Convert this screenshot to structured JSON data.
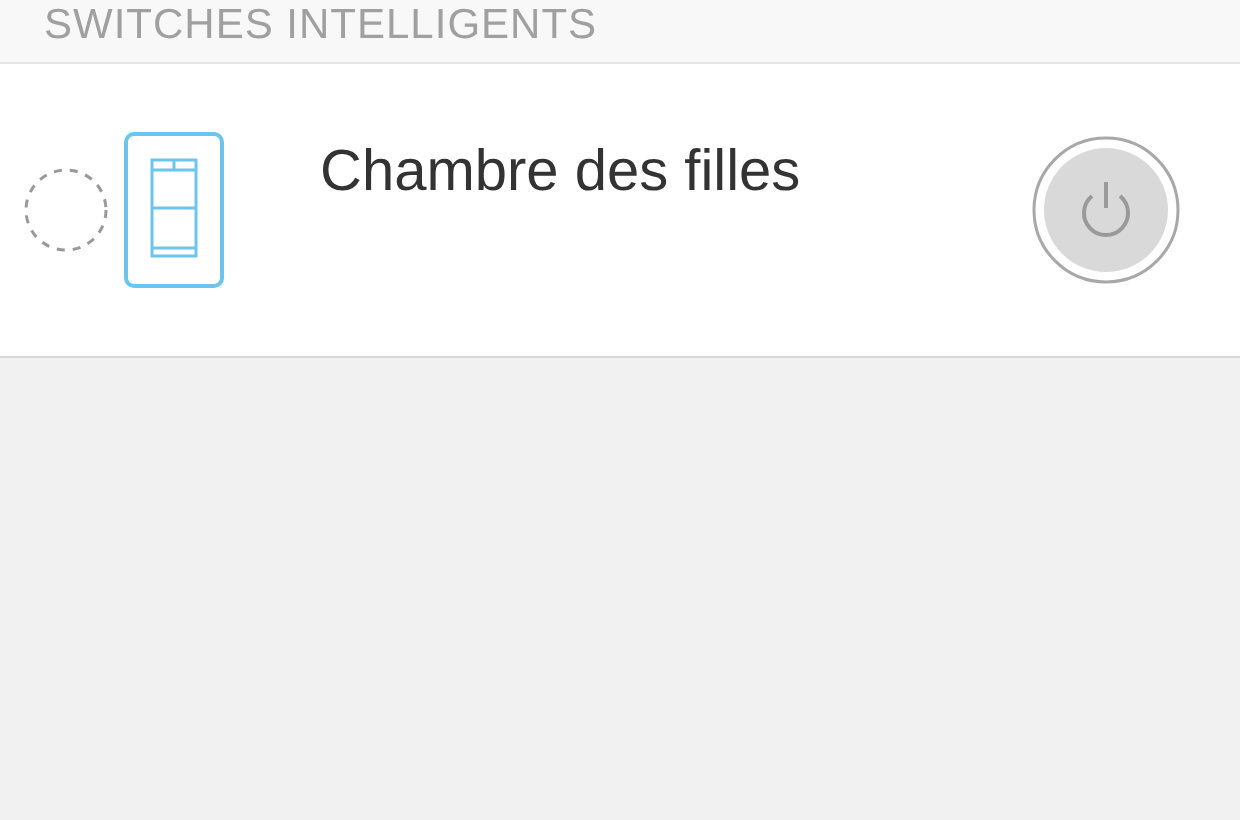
{
  "section_header": {
    "title": "SWITCHES INTELLIGENTS"
  },
  "devices": [
    {
      "name": "Chambre des filles",
      "selected": false,
      "on": false
    }
  ]
}
